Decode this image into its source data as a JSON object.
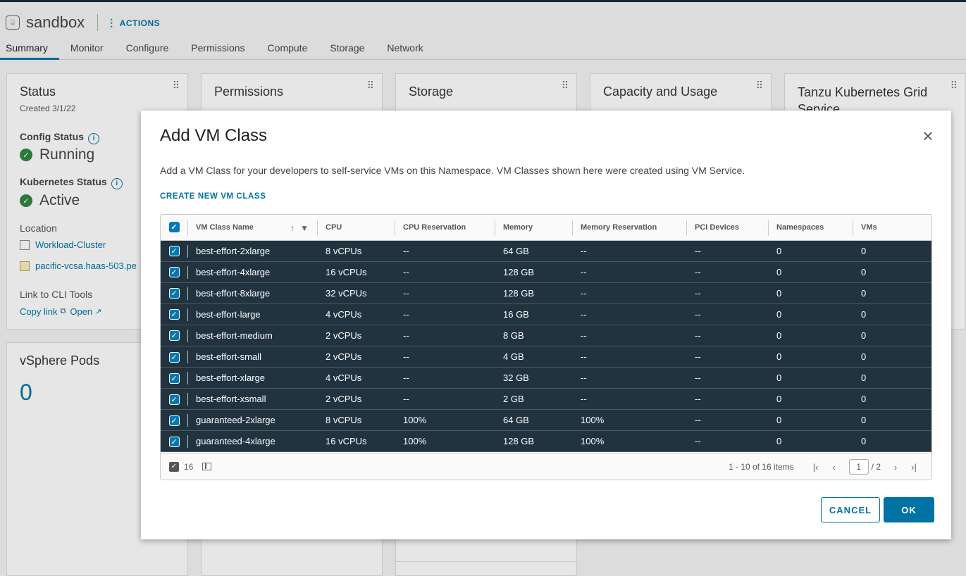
{
  "namespace": {
    "title": "sandbox",
    "actions_label": "ACTIONS",
    "tabs": [
      "Summary",
      "Monitor",
      "Configure",
      "Permissions",
      "Compute",
      "Storage",
      "Network"
    ]
  },
  "cards": {
    "status": {
      "title": "Status",
      "created": "Created 3/1/22",
      "config_status_label": "Config Status",
      "config_status_value": "Running",
      "k8s_status_label": "Kubernetes Status",
      "k8s_status_value": "Active",
      "location_label": "Location",
      "location_cluster": "Workload-Cluster",
      "location_vcenter": "pacific-vcsa.haas-503.pe",
      "cli_label": "Link to CLI Tools",
      "copy_link": "Copy link",
      "open_link": "Open"
    },
    "permissions": {
      "title": "Permissions"
    },
    "storage": {
      "title": "Storage"
    },
    "capacity": {
      "title": "Capacity and Usage"
    },
    "tanzu": {
      "title": "Tanzu Kubernetes Grid Service"
    },
    "pods": {
      "title": "vSphere Pods",
      "count": "0"
    }
  },
  "modal": {
    "title": "Add VM Class",
    "description": "Add a VM Class for your developers to self-service VMs on this Namespace. VM Classes shown here were created using VM Service.",
    "create_link": "CREATE NEW VM CLASS",
    "columns": [
      "VM Class Name",
      "CPU",
      "CPU Reservation",
      "Memory",
      "Memory Reservation",
      "PCI Devices",
      "Namespaces",
      "VMs"
    ],
    "rows": [
      [
        "best-effort-2xlarge",
        "8 vCPUs",
        "--",
        "64 GB",
        "--",
        "--",
        "0",
        "0"
      ],
      [
        "best-effort-4xlarge",
        "16 vCPUs",
        "--",
        "128 GB",
        "--",
        "--",
        "0",
        "0"
      ],
      [
        "best-effort-8xlarge",
        "32 vCPUs",
        "--",
        "128 GB",
        "--",
        "--",
        "0",
        "0"
      ],
      [
        "best-effort-large",
        "4 vCPUs",
        "--",
        "16 GB",
        "--",
        "--",
        "0",
        "0"
      ],
      [
        "best-effort-medium",
        "2 vCPUs",
        "--",
        "8 GB",
        "--",
        "--",
        "0",
        "0"
      ],
      [
        "best-effort-small",
        "2 vCPUs",
        "--",
        "4 GB",
        "--",
        "--",
        "0",
        "0"
      ],
      [
        "best-effort-xlarge",
        "4 vCPUs",
        "--",
        "32 GB",
        "--",
        "--",
        "0",
        "0"
      ],
      [
        "best-effort-xsmall",
        "2 vCPUs",
        "--",
        "2 GB",
        "--",
        "--",
        "0",
        "0"
      ],
      [
        "guaranteed-2xlarge",
        "8 vCPUs",
        "100%",
        "64 GB",
        "100%",
        "--",
        "0",
        "0"
      ],
      [
        "guaranteed-4xlarge",
        "16 vCPUs",
        "100%",
        "128 GB",
        "100%",
        "--",
        "0",
        "0"
      ]
    ],
    "footer": {
      "selected_count": "16",
      "range": "1 - 10 of 16 items",
      "page_current": "1",
      "page_total": "/ 2"
    },
    "cancel_label": "CANCEL",
    "ok_label": "OK"
  },
  "colors": {
    "accent": "#0072a3",
    "selected_row": "#21333f",
    "success": "#2e8540"
  },
  "icons": [
    "namespace-icon",
    "info-icon",
    "check-circle-icon",
    "cluster-icon",
    "vcenter-icon",
    "copy-icon",
    "external-link-icon",
    "close-icon",
    "sort-up-icon",
    "filter-icon",
    "checkbox-icon",
    "column-toggle-icon",
    "first-page-icon",
    "prev-page-icon",
    "next-page-icon",
    "last-page-icon",
    "grip-icon"
  ]
}
